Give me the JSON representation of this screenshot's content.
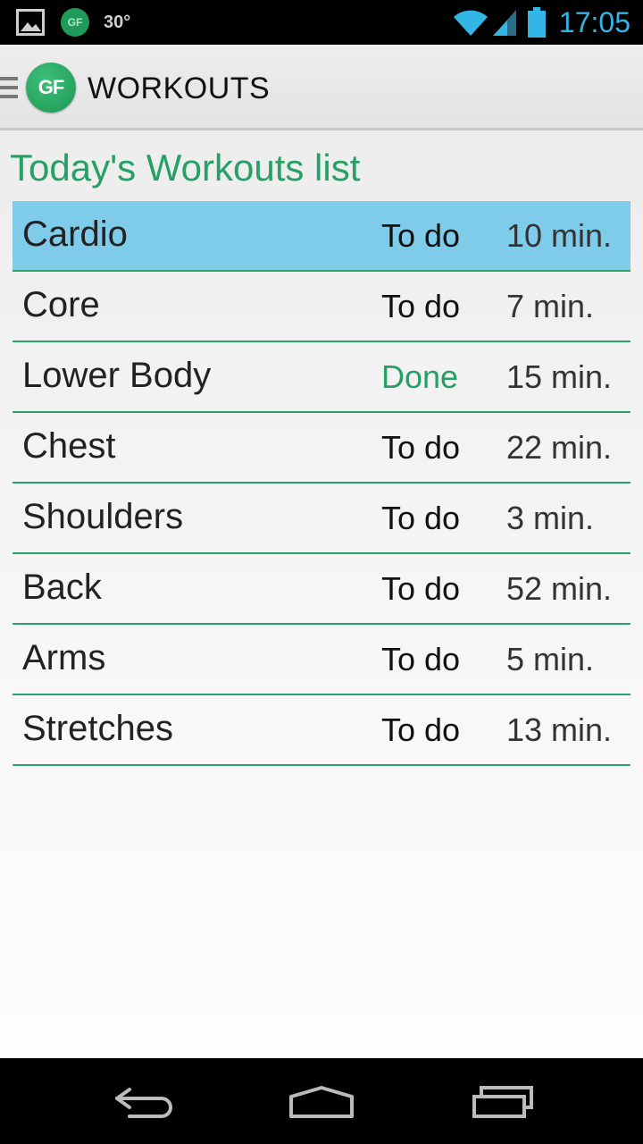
{
  "status_bar": {
    "temperature": "30°",
    "time": "17:05",
    "notif_app_abbrev": "GF",
    "time_color": "#33b5e5"
  },
  "action_bar": {
    "logo_text": "GF",
    "title": "WORKOUTS"
  },
  "list": {
    "title": "Today's Workouts list",
    "accent_color": "#27a065",
    "selected_color": "#7ecbea",
    "items": [
      {
        "name": "Cardio",
        "status": "To do",
        "duration": "10 min."
      },
      {
        "name": "Core",
        "status": "To do",
        "duration": "7 min."
      },
      {
        "name": "Lower Body",
        "status": "Done",
        "duration": "15 min."
      },
      {
        "name": "Chest",
        "status": "To do",
        "duration": "22 min."
      },
      {
        "name": "Shoulders",
        "status": "To do",
        "duration": "3 min."
      },
      {
        "name": "Back",
        "status": "To do",
        "duration": "52 min."
      },
      {
        "name": "Arms",
        "status": "To do",
        "duration": "5 min."
      },
      {
        "name": "Stretches",
        "status": "To do",
        "duration": "13 min."
      }
    ]
  },
  "icons": {
    "status_bar": [
      "image-notification-icon",
      "app-notification-icon",
      "wifi-icon",
      "signal-icon",
      "battery-icon"
    ],
    "nav_bar": [
      "back-icon",
      "home-icon",
      "recent-apps-icon"
    ]
  }
}
